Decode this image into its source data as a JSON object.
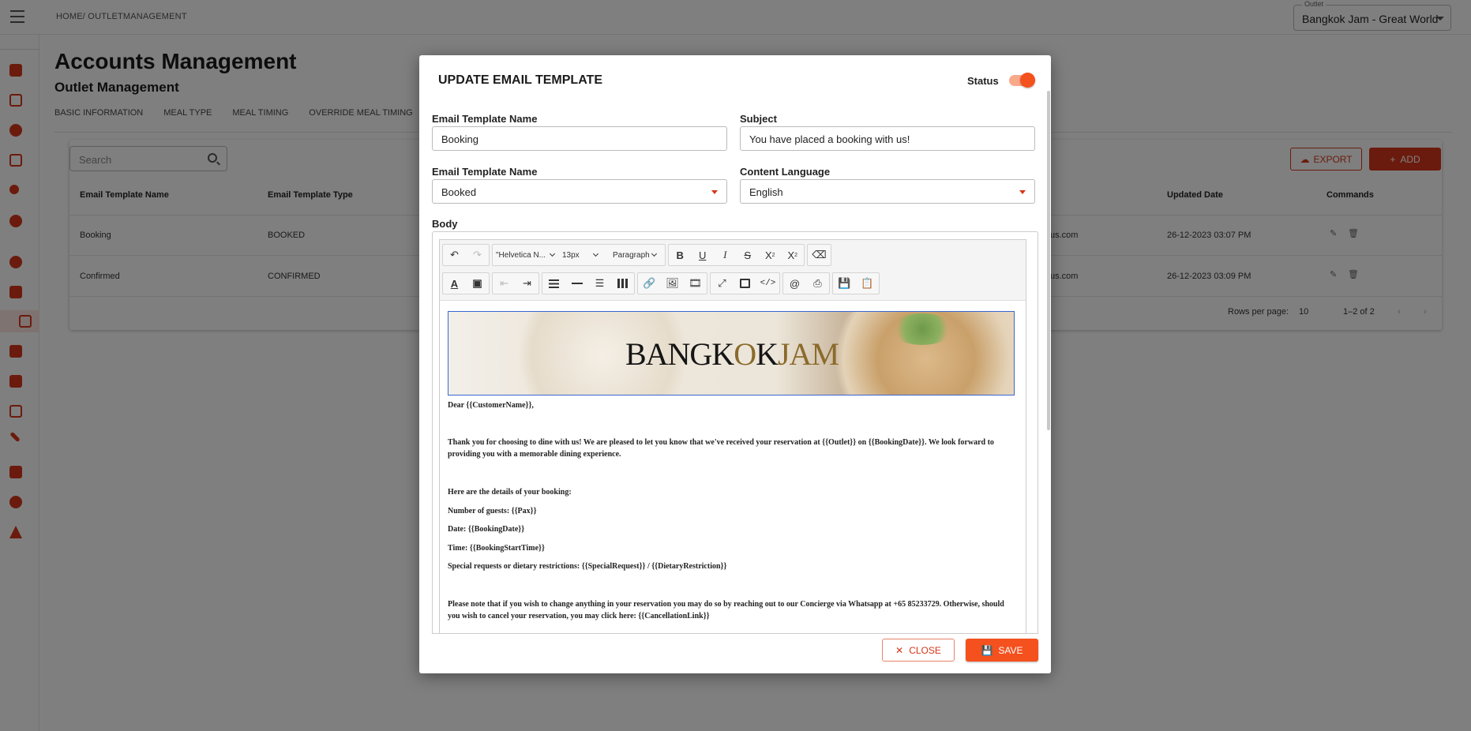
{
  "breadcrumb": "HOME/ OUTLETMANAGEMENT",
  "outlet": {
    "label": "Outlet",
    "value": "Bangkok Jam - Great World"
  },
  "page": {
    "title": "Accounts Management",
    "subtitle": "Outlet Management"
  },
  "tabs": [
    "BASIC INFORMATION",
    "MEAL TYPE",
    "MEAL TIMING",
    "OVERRIDE MEAL TIMING"
  ],
  "toolbar": {
    "search_placeholder": "Search",
    "export_label": "EXPORT",
    "add_label": "ADD"
  },
  "table": {
    "headers": [
      "Email Template Name",
      "Email Template Type",
      "Updated Date",
      "Commands"
    ],
    "rows": [
      {
        "name": "Booking",
        "type": "BOOKED",
        "email_fragment": "us.com",
        "updated": "26-12-2023 03:07 PM"
      },
      {
        "name": "Confirmed",
        "type": "CONFIRMED",
        "email_fragment": "us.com",
        "updated": "26-12-2023 03:09 PM"
      }
    ],
    "pagination": {
      "rows_per_page_label": "Rows per page:",
      "rows_per_page": "10",
      "range": "1–2 of 2"
    }
  },
  "modal": {
    "title": "UPDATE EMAIL TEMPLATE",
    "status_label": "Status",
    "status_on": true,
    "fields": {
      "template_name_label": "Email Template Name",
      "template_name_value": "Booking",
      "subject_label": "Subject",
      "subject_value": "You have placed a booking with us!",
      "template_type_label": "Email Template Name",
      "template_type_value": "Booked",
      "language_label": "Content Language",
      "language_value": "English",
      "body_label": "Body"
    },
    "editor": {
      "font_family": "\"Helvetica N...",
      "font_size": "13px",
      "block_format": "Paragraph",
      "banner_text_dark_1": "BANGK",
      "banner_text_gold_1": "O",
      "banner_text_dark_2": "K",
      "banner_text_gold_2": "JAM",
      "lines": [
        "Dear {{CustomerName}},",
        "Thank you for choosing to dine with us! We are pleased to let you know that we've received your reservation at {{Outlet}} on {{BookingDate}}. We look forward to providing you with a memorable dining experience.",
        "Here are the details of your booking:",
        "Number of guests: {{Pax}}",
        "Date: {{BookingDate}}",
        "Time: {{BookingStartTime}}",
        "Special requests or dietary restrictions: {{SpecialRequest}} / {{DietaryRestriction}}",
        "Please note that if you wish to change anything in your reservation you may do so by reaching out to our Concierge via Whatsapp at +65 85233729. Otherwise, should you wish to cancel your reservation, you may click here: {{CancellationLink}}"
      ]
    },
    "close_label": "CLOSE",
    "save_label": "SAVE"
  },
  "colors": {
    "accent": "#d7361a",
    "accent_bright": "#f4511e",
    "toggle_track": "#f8a989"
  }
}
